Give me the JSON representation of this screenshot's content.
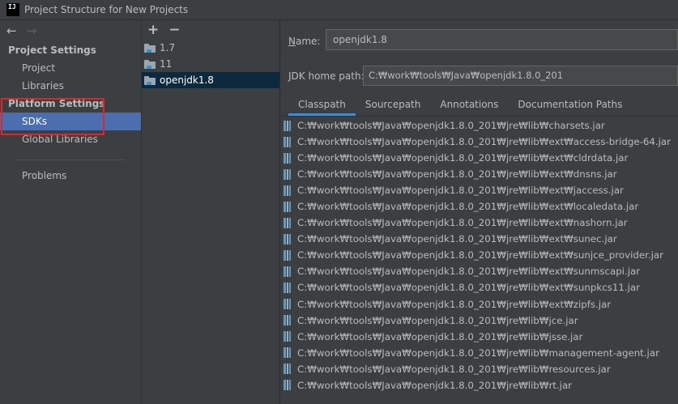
{
  "window": {
    "title": "Project Structure for New Projects",
    "logo_text": "IJ"
  },
  "nav": {
    "back_glyph": "←",
    "forward_glyph": "→"
  },
  "sidebar": {
    "project_settings_header": "Project Settings",
    "project_items": [
      "Project",
      "Libraries"
    ],
    "platform_settings_header": "Platform Settings",
    "platform_items": [
      "SDKs",
      "Global Libraries"
    ],
    "other_items": [
      "Problems"
    ],
    "selected": "SDKs"
  },
  "sdk_toolbar": {
    "add_glyph": "+",
    "remove_glyph": "−"
  },
  "sdk_list": [
    {
      "label": "1.7",
      "selected": false
    },
    {
      "label": "11",
      "selected": false
    },
    {
      "label": "openjdk1.8",
      "selected": true
    }
  ],
  "detail": {
    "name_label_underlined": "N",
    "name_label_rest": "ame:",
    "name_value": "openjdk1.8",
    "jdk_home_label": "JDK home path:",
    "jdk_home_value": "C:₩work₩tools₩Java₩openjdk1.8.0_201",
    "tabs": [
      "Classpath",
      "Sourcepath",
      "Annotations",
      "Documentation Paths"
    ],
    "active_tab": "Classpath",
    "classpath": [
      "C:₩work₩tools₩Java₩openjdk1.8.0_201₩jre₩lib₩charsets.jar",
      "C:₩work₩tools₩Java₩openjdk1.8.0_201₩jre₩lib₩ext₩access-bridge-64.jar",
      "C:₩work₩tools₩Java₩openjdk1.8.0_201₩jre₩lib₩ext₩cldrdata.jar",
      "C:₩work₩tools₩Java₩openjdk1.8.0_201₩jre₩lib₩ext₩dnsns.jar",
      "C:₩work₩tools₩Java₩openjdk1.8.0_201₩jre₩lib₩ext₩jaccess.jar",
      "C:₩work₩tools₩Java₩openjdk1.8.0_201₩jre₩lib₩ext₩localedata.jar",
      "C:₩work₩tools₩Java₩openjdk1.8.0_201₩jre₩lib₩ext₩nashorn.jar",
      "C:₩work₩tools₩Java₩openjdk1.8.0_201₩jre₩lib₩ext₩sunec.jar",
      "C:₩work₩tools₩Java₩openjdk1.8.0_201₩jre₩lib₩ext₩sunjce_provider.jar",
      "C:₩work₩tools₩Java₩openjdk1.8.0_201₩jre₩lib₩ext₩sunmscapi.jar",
      "C:₩work₩tools₩Java₩openjdk1.8.0_201₩jre₩lib₩ext₩sunpkcs11.jar",
      "C:₩work₩tools₩Java₩openjdk1.8.0_201₩jre₩lib₩ext₩zipfs.jar",
      "C:₩work₩tools₩Java₩openjdk1.8.0_201₩jre₩lib₩jce.jar",
      "C:₩work₩tools₩Java₩openjdk1.8.0_201₩jre₩lib₩jsse.jar",
      "C:₩work₩tools₩Java₩openjdk1.8.0_201₩jre₩lib₩management-agent.jar",
      "C:₩work₩tools₩Java₩openjdk1.8.0_201₩jre₩lib₩resources.jar",
      "C:₩work₩tools₩Java₩openjdk1.8.0_201₩jre₩lib₩rt.jar"
    ]
  },
  "colors": {
    "background": "#3c3f41",
    "sidebar_selection": "#4b6eaf",
    "list_selection": "#0d293e",
    "highlight_box": "#e0262c",
    "tab_underline": "#4a88c7"
  }
}
